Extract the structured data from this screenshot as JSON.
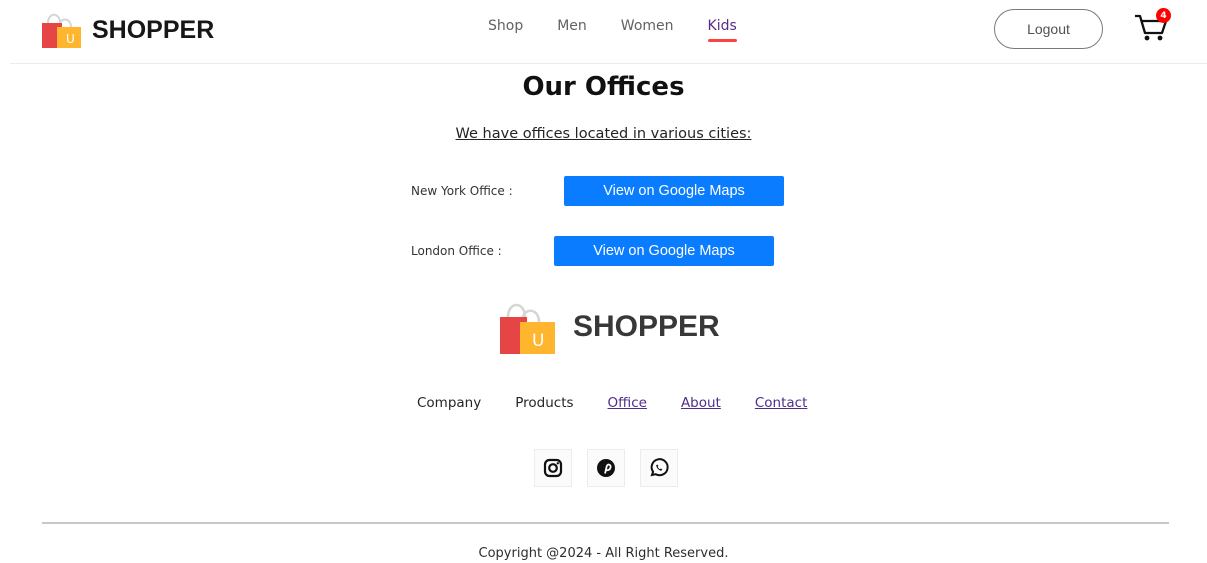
{
  "header": {
    "brand": "SHOPPER",
    "menu": [
      {
        "label": "Shop"
      },
      {
        "label": "Men"
      },
      {
        "label": "Women"
      },
      {
        "label": "Kids"
      }
    ],
    "logout_label": "Logout",
    "cart_count": "4",
    "icons": {
      "brand_logo": "shopping-bag-icon",
      "cart": "cart-icon"
    }
  },
  "main": {
    "title": "Our Offices",
    "subtitle": "We have offices located in various cities:",
    "offices": [
      {
        "label": "New York Office :",
        "button_label": "View on Google Maps"
      },
      {
        "label": "London Office :",
        "button_label": "View on Google Maps"
      }
    ]
  },
  "footer": {
    "brand": "SHOPPER",
    "links": [
      {
        "label": "Company"
      },
      {
        "label": "Products"
      },
      {
        "label": "Office"
      },
      {
        "label": "About"
      },
      {
        "label": "Contact"
      }
    ],
    "social_icons": [
      "instagram-icon",
      "pinterest-icon",
      "whatsapp-icon"
    ],
    "copyright": "Copyright @2024 - All Right Reserved."
  },
  "colors": {
    "accent_blue": "#0a7cff",
    "nav_active": "#5b2b8a",
    "underline": "#ff4141",
    "badge": "#ff0000"
  }
}
